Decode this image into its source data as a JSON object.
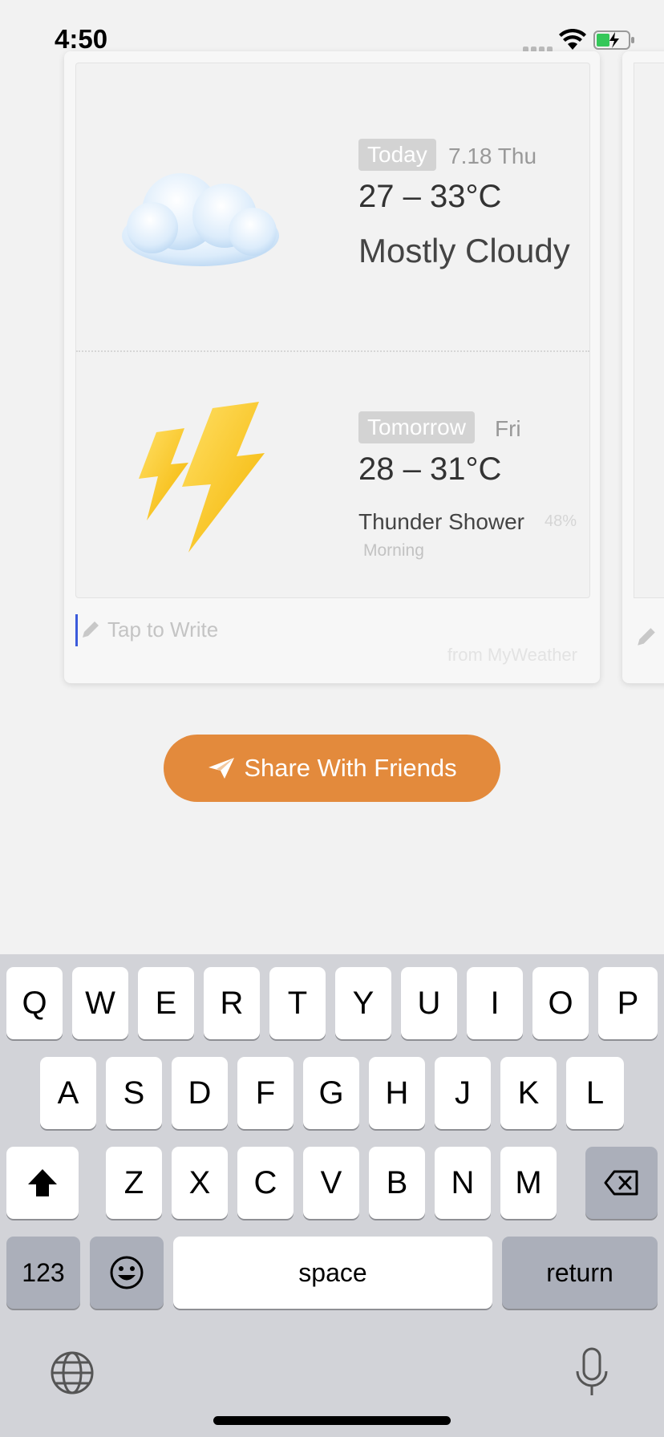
{
  "status_bar": {
    "time": "4:50",
    "icons": [
      "signal-dots-icon",
      "wifi-icon",
      "battery-charging-icon"
    ]
  },
  "card": {
    "today": {
      "tag": "Today",
      "date": "7.18 Thu",
      "temp": "27 – 33°C",
      "condition": "Mostly Cloudy",
      "icon": "cloud-icon"
    },
    "tomorrow": {
      "tag": "Tomorrow",
      "day": "Fri",
      "temp": "28 – 31°C",
      "condition": "Thunder Shower",
      "precip": "48%",
      "period": "Morning",
      "icon": "lightning-icon"
    },
    "write_placeholder": "Tap to Write",
    "source": "from MyWeather"
  },
  "share_button": {
    "label": "Share With Friends",
    "icon": "paper-plane-icon",
    "color": "#e38a3c"
  },
  "keyboard": {
    "row1": [
      "Q",
      "W",
      "E",
      "R",
      "T",
      "Y",
      "U",
      "I",
      "O",
      "P"
    ],
    "row2": [
      "A",
      "S",
      "D",
      "F",
      "G",
      "H",
      "J",
      "K",
      "L"
    ],
    "row3": [
      "Z",
      "X",
      "C",
      "V",
      "B",
      "N",
      "M"
    ],
    "numbers_label": "123",
    "space_label": "space",
    "return_label": "return"
  }
}
